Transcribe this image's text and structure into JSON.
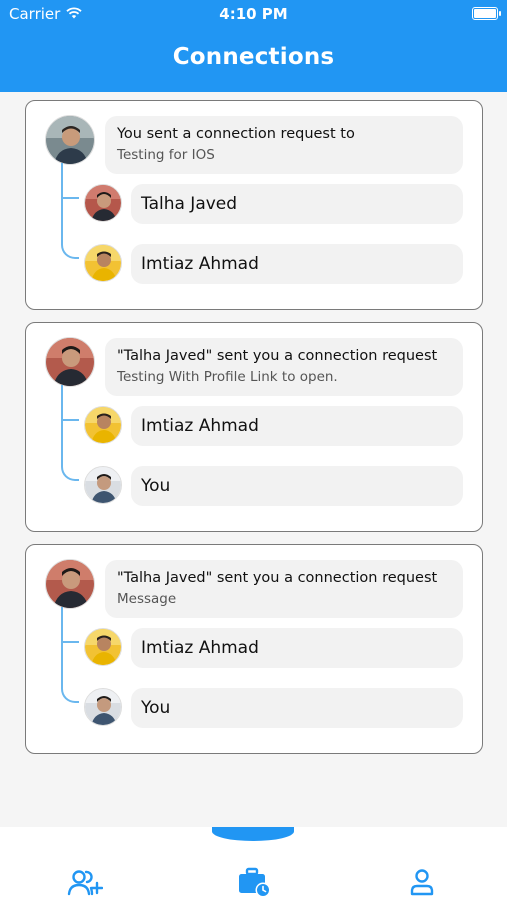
{
  "status_bar": {
    "carrier": "Carrier",
    "time": "4:10 PM"
  },
  "header": {
    "title": "Connections"
  },
  "cards": [
    {
      "main": {
        "title": "You sent a connection request to",
        "subtitle": "Testing for IOS"
      },
      "people": [
        {
          "name": "Talha Javed"
        },
        {
          "name": "Imtiaz Ahmad"
        }
      ]
    },
    {
      "main": {
        "title": "\"Talha Javed\" sent you a connection request",
        "subtitle": "Testing With Profile Link to open."
      },
      "people": [
        {
          "name": "Imtiaz Ahmad"
        },
        {
          "name": "You"
        }
      ]
    },
    {
      "main": {
        "title": "\"Talha Javed\" sent you a connection request",
        "subtitle": "Message"
      },
      "people": [
        {
          "name": "Imtiaz Ahmad"
        },
        {
          "name": "You"
        }
      ]
    }
  ],
  "bottom_nav": {
    "items": [
      {
        "icon": "add-user-icon"
      },
      {
        "icon": "briefcase-clock-icon"
      },
      {
        "icon": "profile-icon"
      }
    ],
    "active": 1
  },
  "colors": {
    "primary": "#2196f3",
    "thread": "#6ab7ee"
  }
}
